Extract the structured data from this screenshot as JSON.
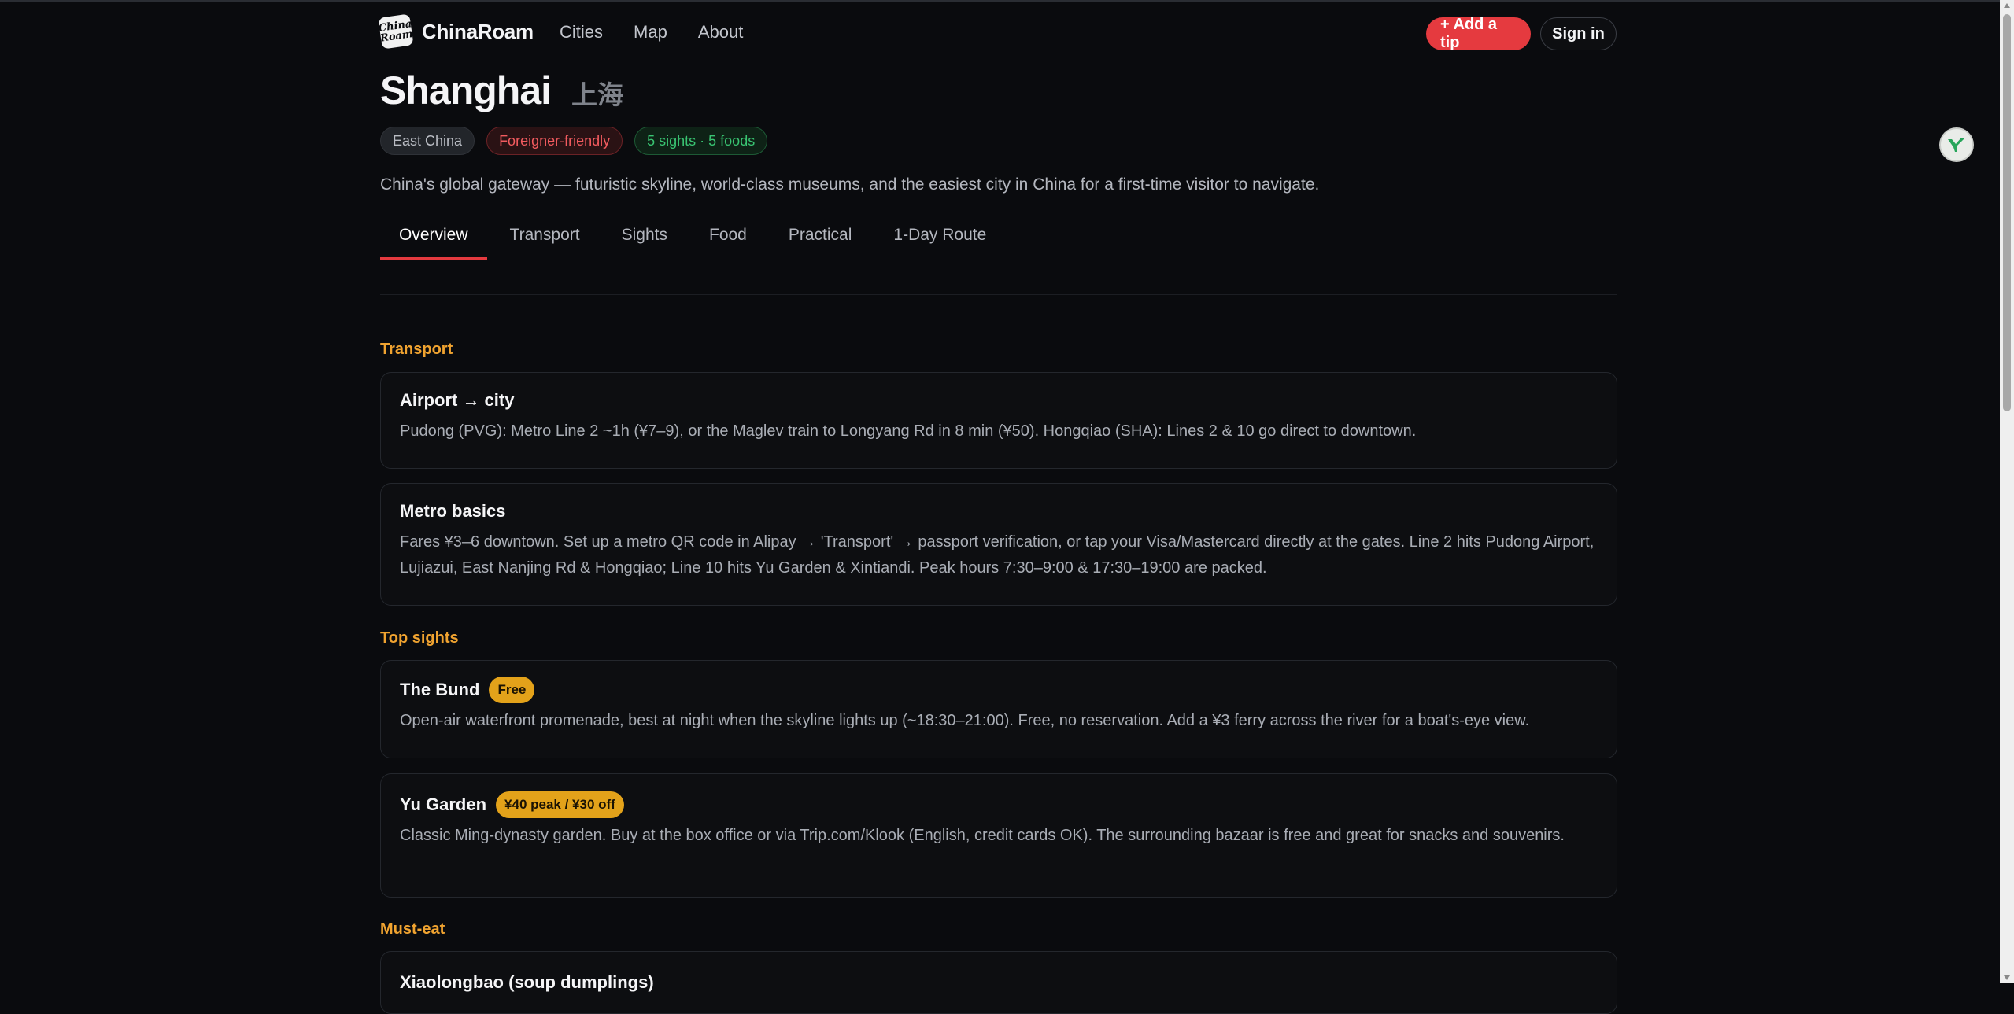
{
  "nav": {
    "logo_text_line1": "China",
    "logo_text_line2": "Roam",
    "brand": "ChinaRoam",
    "links": [
      "Cities",
      "Map",
      "About"
    ],
    "add_tip": "+ Add a tip",
    "sign_in": "Sign in"
  },
  "city": {
    "name": "Shanghai",
    "name_zh": "上海",
    "tags": {
      "region": "East China",
      "friendly": "Foreigner-friendly",
      "counts": "5 sights · 5 foods"
    },
    "tagline": "China's global gateway — futuristic skyline, world-class museums, and the easiest city in China for a first-time visitor to navigate."
  },
  "tabs": [
    "Overview",
    "Transport",
    "Sights",
    "Food",
    "Practical",
    "1-Day Route"
  ],
  "active_tab": "Overview",
  "sections": {
    "transport": {
      "label": "Transport",
      "cards": [
        {
          "title": "Airport → city",
          "body": "Pudong (PVG): Metro Line 2 ~1h (¥7–9), or the Maglev train to Longyang Rd in 8 min (¥50). Hongqiao (SHA): Lines 2 & 10 go direct to downtown."
        },
        {
          "title": "Metro basics",
          "body": "Fares ¥3–6 downtown. Set up a metro QR code in Alipay → 'Transport' → passport verification, or tap your Visa/Mastercard directly at the gates. Line 2 hits Pudong Airport, Lujiazui, East Nanjing Rd & Hongqiao; Line 10 hits Yu Garden & Xintiandi. Peak hours 7:30–9:00 & 17:30–19:00 are packed."
        }
      ]
    },
    "sights": {
      "label": "Top sights",
      "cards": [
        {
          "title": "The Bund",
          "badge": "Free",
          "body": "Open-air waterfront promenade, best at night when the skyline lights up (~18:30–21:00). Free, no reservation. Add a ¥3 ferry across the river for a boat's-eye view."
        },
        {
          "title": "Yu Garden",
          "badge": "¥40 peak / ¥30 off",
          "body": "Classic Ming-dynasty garden. Buy at the box office or via Trip.com/Klook (English, credit cards OK). The surrounding bazaar is free and great for snacks and souvenirs."
        }
      ]
    },
    "food": {
      "label": "Must-eat",
      "cards": [
        {
          "title": "Xiaolongbao (soup dumplings)"
        }
      ]
    }
  },
  "colors": {
    "accent_red": "#e53a3f",
    "section_orange": "#f0a330",
    "badge_gold": "#e3a21a",
    "background": "#0a0b0e"
  },
  "icons": {
    "logo": "chinaroam-logo",
    "floating_widget": "assistant-widget-icon"
  }
}
